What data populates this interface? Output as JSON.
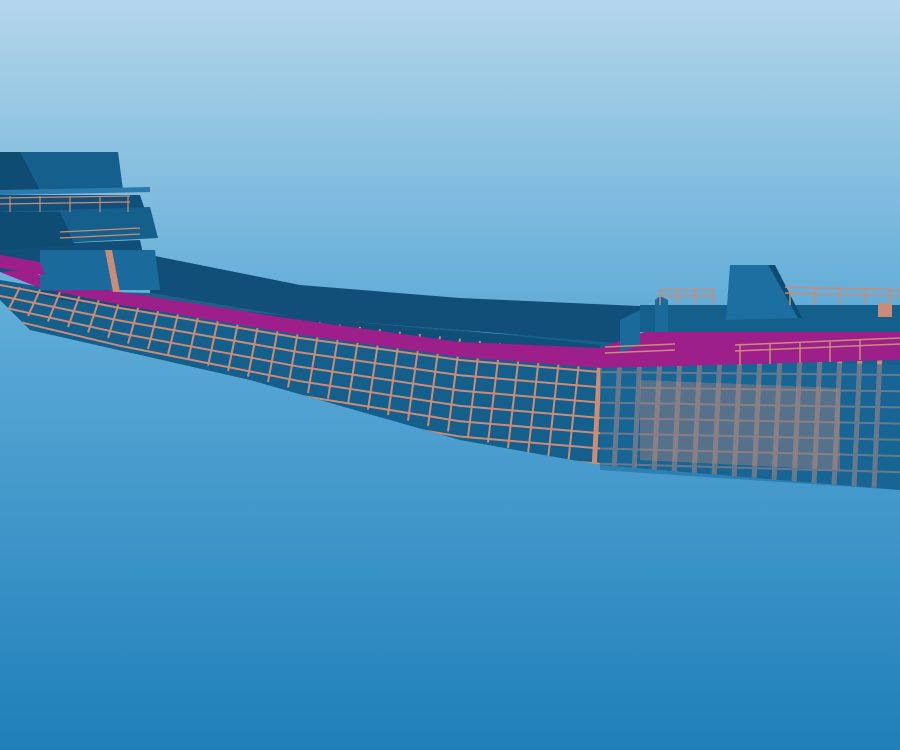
{
  "viewport": {
    "background_top": "#b4d6ea",
    "background_mid": "#5aa9d6",
    "background_bottom": "#1f7fb9"
  },
  "ship": {
    "hull_color": "#155f8c",
    "hull_dark": "#0f4c73",
    "hull_light": "#2a7aab",
    "frame_color": "#c98c78",
    "deck_color": "#9c1f8a",
    "icons": [
      "superstructure-icon",
      "hull-icon",
      "deck-icon",
      "frame-icon"
    ]
  }
}
